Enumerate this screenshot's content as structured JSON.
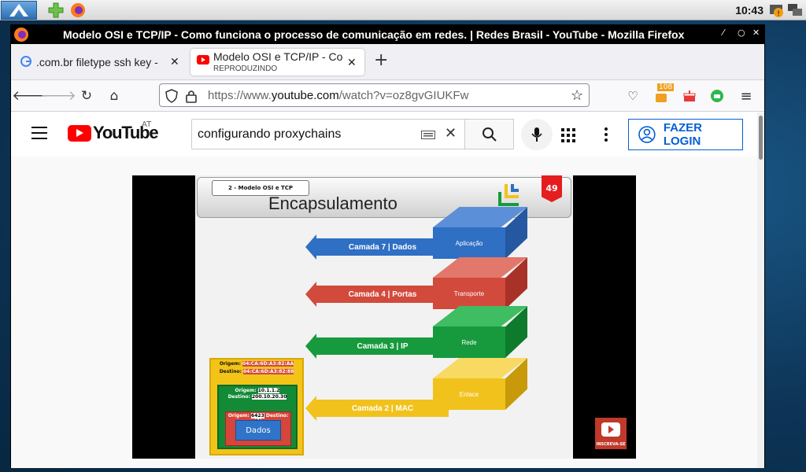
{
  "panel": {
    "clock": "10:43"
  },
  "window": {
    "title": "Modelo OSI e TCP/IP - Como funciona o processo de comunicação em redes. | Redes Brasil - YouTube - Mozilla Firefox"
  },
  "tabs": [
    {
      "label": ".com.br filetype ssh key -",
      "icon": "google-icon"
    },
    {
      "label": "Modelo OSI e TCP/IP - Co",
      "sublabel": "REPRODUZINDO",
      "icon": "youtube-icon"
    }
  ],
  "navbar": {
    "url_prefix": "https://www.",
    "url_host": "youtube.com",
    "url_path": "/watch?v=oz8gvGIUKFw",
    "badge_count": "108"
  },
  "youtube": {
    "logo_text": "YouTube",
    "country": "AT",
    "search_value": "configurando proxychains",
    "login_label": "FAZER LOGIN"
  },
  "slide": {
    "subtitle": "2 - Modelo OSI e TCP",
    "title": "Encapsulamento",
    "badge": "49",
    "layers": [
      {
        "arrow": "Camada 7 | Dados",
        "block": "Aplicação",
        "color": "#2f6fc4"
      },
      {
        "arrow": "Camada 4 | Portas",
        "block": "Transporte",
        "color": "#d24a3c"
      },
      {
        "arrow": "Camada 3 | IP",
        "block": "Rede",
        "color": "#179a3d"
      },
      {
        "arrow": "Camada 2 | MAC",
        "block": "Enlace",
        "color": "#f2c21c"
      }
    ],
    "frame": {
      "mac_origin_label": "Origem:",
      "mac_origin": "04:CA:6D:A3:82:AA",
      "mac_dest_label": "Destino:",
      "mac_dest": "04:CA:6D:A3:82:88",
      "ip_origin_label": "Origem:",
      "ip_origin": "10.1.1.2",
      "ip_dest_label": "Destino:",
      "ip_dest": "200.10.20.30",
      "port_origin_label": "Origem:",
      "port_origin": "6423",
      "port_dest_label": "Destino:",
      "port_dest": "80",
      "data": "Dados"
    },
    "subscribe": "INSCREVA-SE"
  }
}
